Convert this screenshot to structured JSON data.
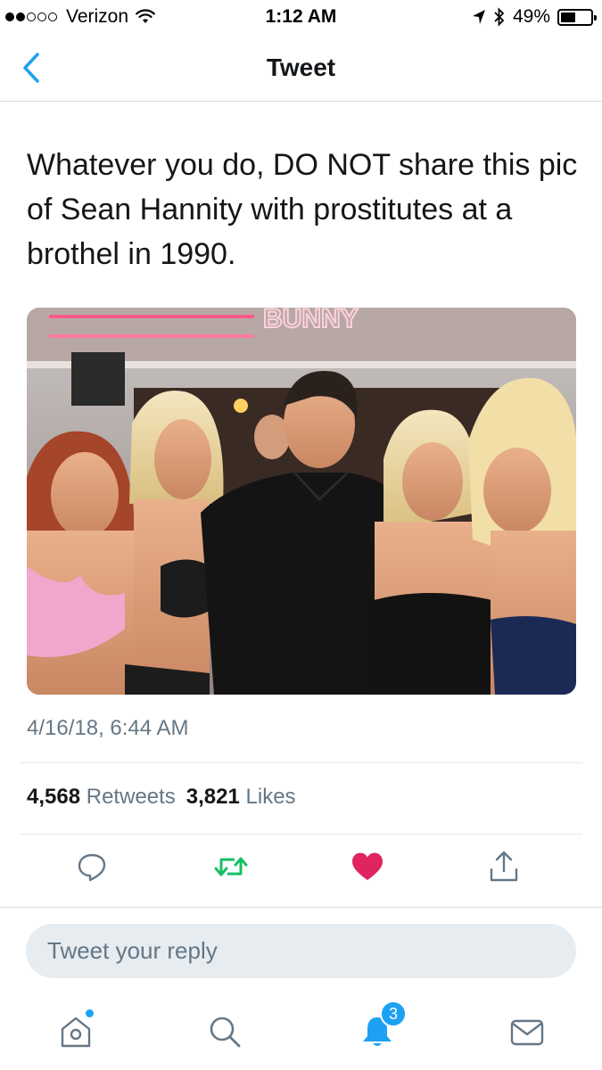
{
  "status_bar": {
    "carrier": "Verizon",
    "time": "1:12 AM",
    "battery": "49%",
    "battery_level": 0.49,
    "signal_bars": 2,
    "icons": [
      "wifi-icon",
      "location-arrow-icon",
      "bluetooth-icon",
      "battery-icon"
    ]
  },
  "nav": {
    "title": "Tweet",
    "back_icon": "chevron-left-icon"
  },
  "tweet": {
    "text": "Whatever you do, DO NOT share this pic of Sean Hannity with prostitutes at a brothel in 1990.",
    "photo_sign_text": "BUNNY",
    "timestamp": "4/16/18, 6:44 AM",
    "retweet_count": "4,568",
    "retweet_label": "Retweets",
    "like_count": "3,821",
    "like_label": "Likes"
  },
  "actions": {
    "items": [
      "reply-icon",
      "retweet-icon",
      "like-heart-icon",
      "share-icon"
    ],
    "retweet_color": "#17bf63",
    "like_color": "#e0245e"
  },
  "reply": {
    "placeholder": "Tweet your reply"
  },
  "tab_bar": {
    "items": [
      "home-icon",
      "search-icon",
      "notifications-bell-icon",
      "messages-envelope-icon"
    ],
    "notifications_badge": "3",
    "accent": "#1da1f2"
  },
  "colors": {
    "accent": "#1da1f2",
    "secondary_text": "#657786",
    "primary_text": "#14171a"
  }
}
